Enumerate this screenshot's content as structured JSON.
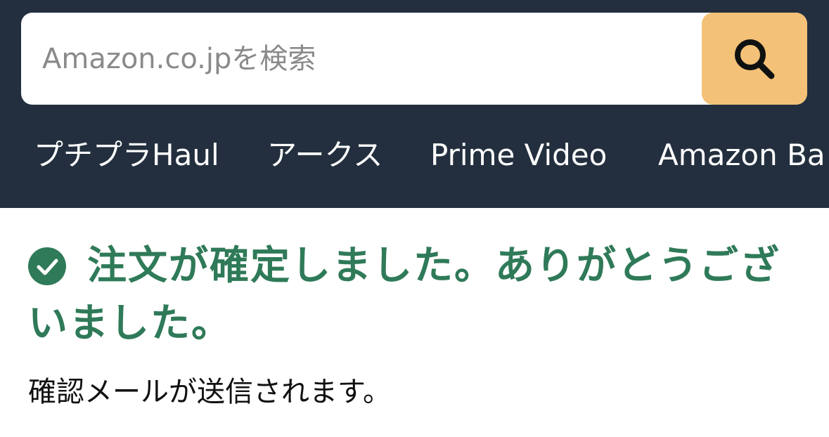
{
  "search": {
    "placeholder": "Amazon.co.jpを検索",
    "button_icon": "search-icon",
    "button_color": "#f3c177"
  },
  "nav": {
    "items": [
      {
        "label": "プチプラHaul"
      },
      {
        "label": "アークス"
      },
      {
        "label": "Prime Video"
      },
      {
        "label": "Amazon Ba"
      }
    ]
  },
  "confirmation": {
    "icon": "check-circle-icon",
    "title": "注文が確定しました。ありがとうございました。",
    "message": "確認メールが送信されます。",
    "accent_color": "#2f7a58"
  },
  "colors": {
    "header_bg": "#232f3e",
    "page_bg": "#ffffff"
  }
}
